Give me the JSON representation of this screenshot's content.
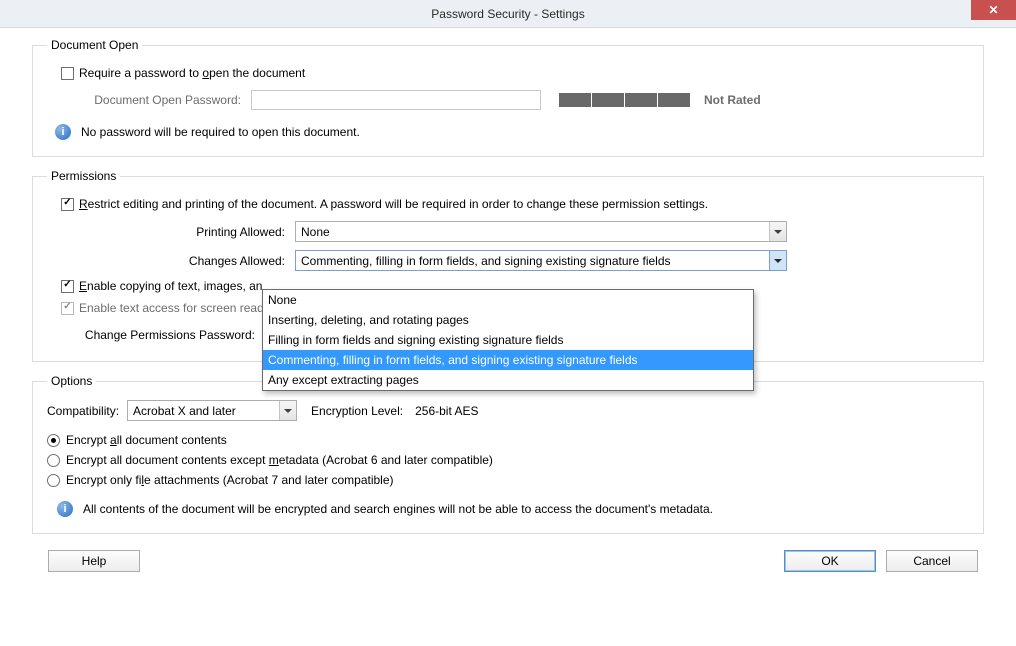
{
  "title": "Password Security - Settings",
  "doc_open": {
    "legend": "Document Open",
    "require_pw_label": "Require a password to open the document",
    "password_label": "Document Open Password:",
    "strength_label": "Not Rated",
    "info": "No password will be required to open this document."
  },
  "permissions": {
    "legend": "Permissions",
    "restrict_label": "Restrict editing and printing of the document. A password will be required in order to change these permission settings.",
    "printing_label": "Printing Allowed:",
    "printing_value": "None",
    "changes_label": "Changes Allowed:",
    "changes_value": "Commenting, filling in form fields, and signing existing signature fields",
    "changes_options": [
      "None",
      "Inserting, deleting, and rotating pages",
      "Filling in form fields and signing existing signature fields",
      "Commenting, filling in form fields, and signing existing signature fields",
      "Any except extracting pages"
    ],
    "enable_copy_label_partial": "Enable copying of text, images, an",
    "enable_screen_label_partial": "Enable text access for screen reade",
    "change_pw_label": "Change Permissions Password:",
    "change_pw_value_partial": "****"
  },
  "options": {
    "legend": "Options",
    "compat_label": "Compatibility:",
    "compat_value": "Acrobat X and later",
    "enc_level_label": "Encryption  Level:",
    "enc_level_value": "256-bit AES",
    "radio_all": "Encrypt all document contents",
    "radio_meta": "Encrypt all document contents except metadata (Acrobat 6 and later compatible)",
    "radio_file": "Encrypt only file attachments (Acrobat 7 and later compatible)",
    "info": "All contents of the document will be encrypted and search engines will not be able to access the document's metadata."
  },
  "buttons": {
    "help": "Help",
    "ok": "OK",
    "cancel": "Cancel"
  }
}
